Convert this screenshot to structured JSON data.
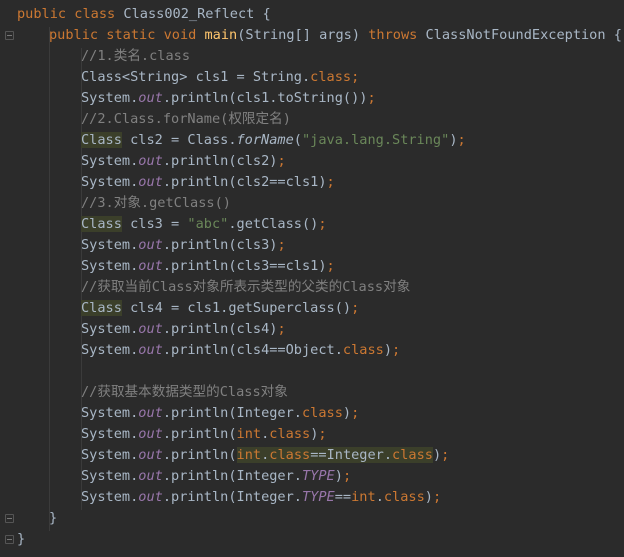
{
  "editor": {
    "lines": [
      {
        "tokens": [
          {
            "t": "public class ",
            "c": "k"
          },
          {
            "t": "Class002_Reflect {",
            "c": ""
          }
        ]
      },
      {
        "tokens": [
          {
            "t": "public static void ",
            "c": "k"
          },
          {
            "t": "main",
            "c": "m"
          },
          {
            "t": "(String[] args) ",
            "c": ""
          },
          {
            "t": "throws ",
            "c": "k"
          },
          {
            "t": "ClassNotFoundException {",
            "c": ""
          }
        ]
      },
      {
        "tokens": [
          {
            "t": "//1.类名.class",
            "c": "c"
          }
        ]
      },
      {
        "tokens": [
          {
            "t": "Class<String> cls1 = String.",
            "c": ""
          },
          {
            "t": "class",
            "c": "k"
          },
          {
            "t": ";",
            "c": "k"
          }
        ]
      },
      {
        "tokens": [
          {
            "t": "System.",
            "c": ""
          },
          {
            "t": "out",
            "c": "f"
          },
          {
            "t": ".println(cls1.toString())",
            "c": ""
          },
          {
            "t": ";",
            "c": "k"
          }
        ]
      },
      {
        "tokens": [
          {
            "t": "//2.Class.forName(权限定名)",
            "c": "c"
          }
        ]
      },
      {
        "tokens": [
          {
            "t": "Class",
            "c": "hl"
          },
          {
            "t": " cls2 = Class.",
            "c": ""
          },
          {
            "t": "forName",
            "c": "i"
          },
          {
            "t": "(",
            "c": ""
          },
          {
            "t": "\"java.lang.String\"",
            "c": "s"
          },
          {
            "t": ")",
            "c": ""
          },
          {
            "t": ";",
            "c": "k"
          }
        ]
      },
      {
        "tokens": [
          {
            "t": "System.",
            "c": ""
          },
          {
            "t": "out",
            "c": "f"
          },
          {
            "t": ".println(cls2)",
            "c": ""
          },
          {
            "t": ";",
            "c": "k"
          }
        ]
      },
      {
        "tokens": [
          {
            "t": "System.",
            "c": ""
          },
          {
            "t": "out",
            "c": "f"
          },
          {
            "t": ".println(cls2==cls1)",
            "c": ""
          },
          {
            "t": ";",
            "c": "k"
          }
        ]
      },
      {
        "tokens": [
          {
            "t": "//3.对象.getClass()",
            "c": "c"
          }
        ]
      },
      {
        "tokens": [
          {
            "t": "Class",
            "c": "hl"
          },
          {
            "t": " cls3 = ",
            "c": ""
          },
          {
            "t": "\"abc\"",
            "c": "s"
          },
          {
            "t": ".getClass()",
            "c": ""
          },
          {
            "t": ";",
            "c": "k"
          }
        ]
      },
      {
        "tokens": [
          {
            "t": "System.",
            "c": ""
          },
          {
            "t": "out",
            "c": "f"
          },
          {
            "t": ".println(cls3)",
            "c": ""
          },
          {
            "t": ";",
            "c": "k"
          }
        ]
      },
      {
        "tokens": [
          {
            "t": "System.",
            "c": ""
          },
          {
            "t": "out",
            "c": "f"
          },
          {
            "t": ".println(cls3==cls1)",
            "c": ""
          },
          {
            "t": ";",
            "c": "k"
          }
        ]
      },
      {
        "tokens": [
          {
            "t": "//获取当前Class对象所表示类型的父类的Class对象",
            "c": "c"
          }
        ]
      },
      {
        "tokens": [
          {
            "t": "Class",
            "c": "hl"
          },
          {
            "t": " cls4 = cls1.getSuperclass()",
            "c": ""
          },
          {
            "t": ";",
            "c": "k"
          }
        ]
      },
      {
        "tokens": [
          {
            "t": "System.",
            "c": ""
          },
          {
            "t": "out",
            "c": "f"
          },
          {
            "t": ".println(cls4)",
            "c": ""
          },
          {
            "t": ";",
            "c": "k"
          }
        ]
      },
      {
        "tokens": [
          {
            "t": "System.",
            "c": ""
          },
          {
            "t": "out",
            "c": "f"
          },
          {
            "t": ".println(cls4==Object.",
            "c": ""
          },
          {
            "t": "class",
            "c": "k"
          },
          {
            "t": ")",
            "c": ""
          },
          {
            "t": ";",
            "c": "k"
          }
        ]
      },
      {
        "tokens": []
      },
      {
        "tokens": [
          {
            "t": "//获取基本数据类型的Class对象",
            "c": "c"
          }
        ]
      },
      {
        "tokens": [
          {
            "t": "System.",
            "c": ""
          },
          {
            "t": "out",
            "c": "f"
          },
          {
            "t": ".println(Integer.",
            "c": ""
          },
          {
            "t": "class",
            "c": "k"
          },
          {
            "t": ")",
            "c": ""
          },
          {
            "t": ";",
            "c": "k"
          }
        ]
      },
      {
        "tokens": [
          {
            "t": "System.",
            "c": ""
          },
          {
            "t": "out",
            "c": "f"
          },
          {
            "t": ".println(",
            "c": ""
          },
          {
            "t": "int",
            "c": "k"
          },
          {
            "t": ".",
            "c": ""
          },
          {
            "t": "class",
            "c": "k"
          },
          {
            "t": ")",
            "c": ""
          },
          {
            "t": ";",
            "c": "k"
          }
        ]
      },
      {
        "tokens": [
          {
            "t": "System.",
            "c": ""
          },
          {
            "t": "out",
            "c": "f"
          },
          {
            "t": ".println(",
            "c": ""
          },
          {
            "t": "int",
            "c": "k hl2"
          },
          {
            "t": ".",
            "c": "hl2"
          },
          {
            "t": "class",
            "c": "k hl2"
          },
          {
            "t": "==Integer.",
            "c": "hl2"
          },
          {
            "t": "class",
            "c": "k hl2"
          },
          {
            "t": ")",
            "c": ""
          },
          {
            "t": ";",
            "c": "k"
          }
        ]
      },
      {
        "tokens": [
          {
            "t": "System.",
            "c": ""
          },
          {
            "t": "out",
            "c": "f"
          },
          {
            "t": ".println(Integer.",
            "c": ""
          },
          {
            "t": "TYPE",
            "c": "f"
          },
          {
            "t": ")",
            "c": ""
          },
          {
            "t": ";",
            "c": "k"
          }
        ]
      },
      {
        "tokens": [
          {
            "t": "System.",
            "c": ""
          },
          {
            "t": "out",
            "c": "f"
          },
          {
            "t": ".println(Integer.",
            "c": ""
          },
          {
            "t": "TYPE",
            "c": "f"
          },
          {
            "t": "==",
            "c": ""
          },
          {
            "t": "int",
            "c": "k"
          },
          {
            "t": ".",
            "c": ""
          },
          {
            "t": "class",
            "c": "k"
          },
          {
            "t": ")",
            "c": ""
          },
          {
            "t": ";",
            "c": "k"
          }
        ]
      },
      {
        "tokens": [
          {
            "t": "}",
            "c": ""
          }
        ]
      },
      {
        "tokens": [
          {
            "t": "}",
            "c": ""
          }
        ]
      }
    ]
  },
  "colors": {
    "background": "#2b2b2b",
    "text": "#a9b7c6",
    "keyword": "#cc7832",
    "method": "#ffc66d",
    "comment": "#808080",
    "string": "#6a8759",
    "static_field": "#9876aa",
    "highlight": "#3b3f2a"
  }
}
